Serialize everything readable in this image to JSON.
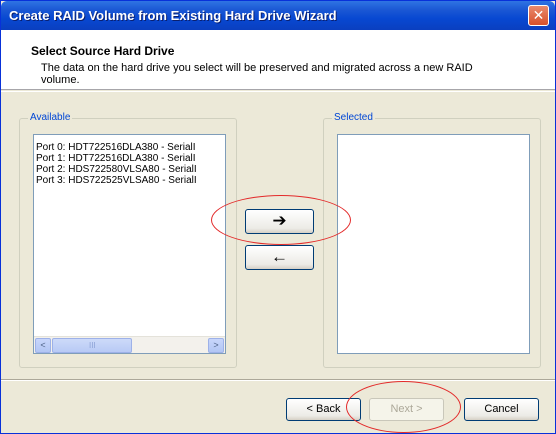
{
  "window": {
    "title": "Create RAID Volume from Existing Hard Drive Wizard",
    "close_glyph": "✕"
  },
  "header": {
    "title": "Select Source Hard Drive",
    "description": "The data on the hard drive you select will be preserved and migrated across a new RAID volume."
  },
  "available": {
    "label": "Available",
    "items": [
      "Port 0: HDT722516DLA380 - SerialI",
      "Port 1: HDT722516DLA380 - SerialI",
      "Port 2: HDS722580VLSA80 - SerialI",
      "Port 3: HDS722525VLSA80 - SerialI"
    ],
    "scroll_left": "<",
    "scroll_right": ">",
    "scroll_grip": "III"
  },
  "selected": {
    "label": "Selected",
    "items": []
  },
  "move_buttons": {
    "add": "➔",
    "remove": "←"
  },
  "footer": {
    "back": "< Back",
    "next": "Next >",
    "cancel": "Cancel"
  },
  "annotation_color": "#e32b2b"
}
